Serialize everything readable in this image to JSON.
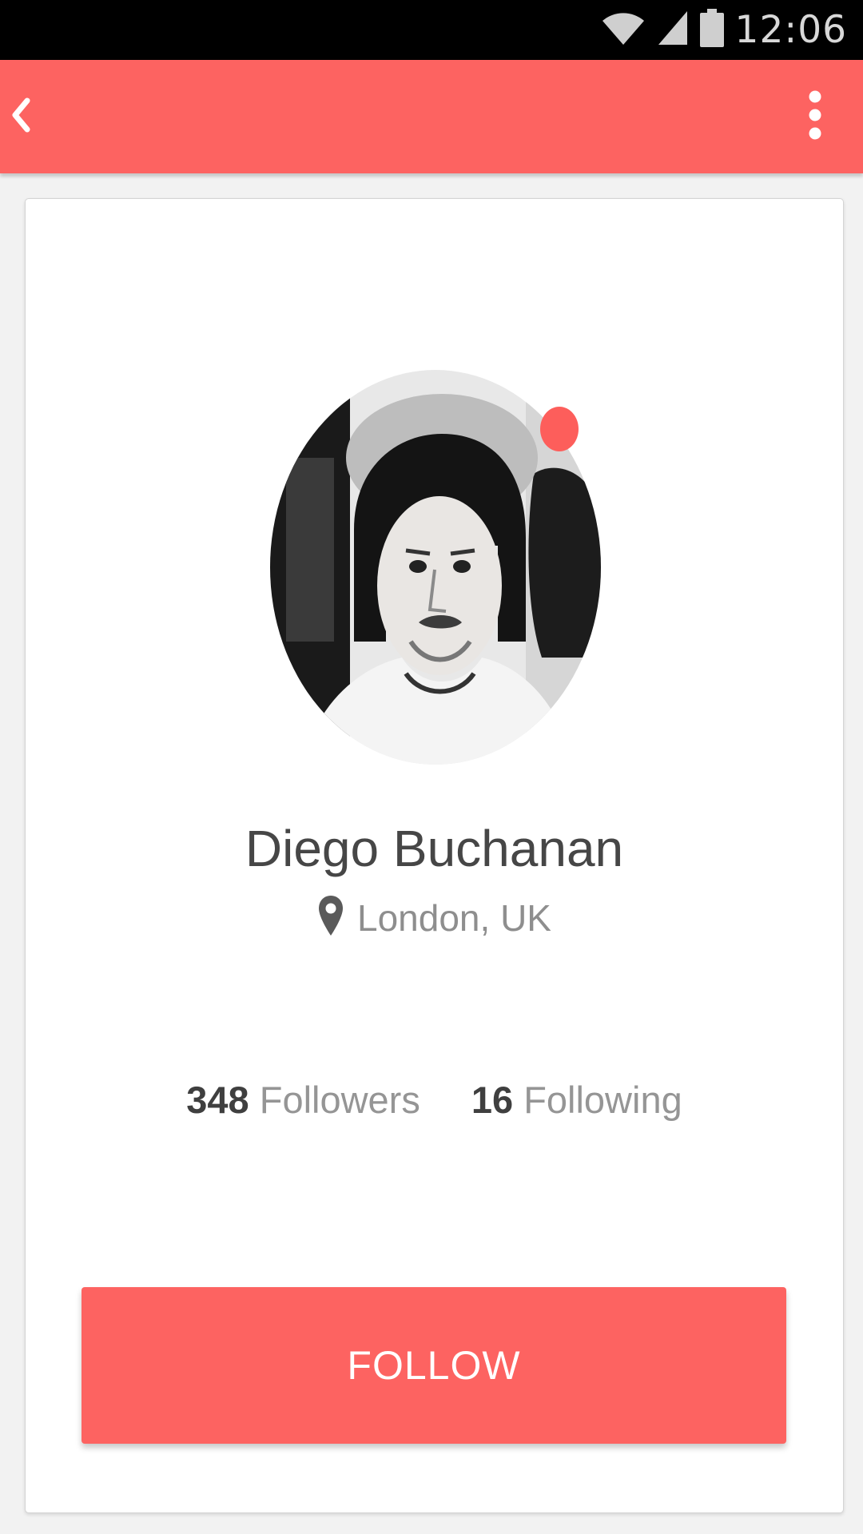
{
  "status_bar": {
    "time": "12:06",
    "icons": [
      "wifi-icon",
      "signal-icon",
      "battery-icon"
    ]
  },
  "app_bar": {
    "back_icon": "chevron-left-icon",
    "menu_icon": "more-vertical-icon",
    "color": "#fd6361"
  },
  "profile": {
    "name": "Diego Buchanan",
    "location": "London, UK",
    "location_icon": "map-pin-icon",
    "online_indicator_color": "#fd5e5b",
    "followers_count": "348",
    "followers_label": "Followers",
    "following_count": "16",
    "following_label": "Following"
  },
  "actions": {
    "follow_label": "FOLLOW",
    "accent_color": "#fd6361"
  }
}
